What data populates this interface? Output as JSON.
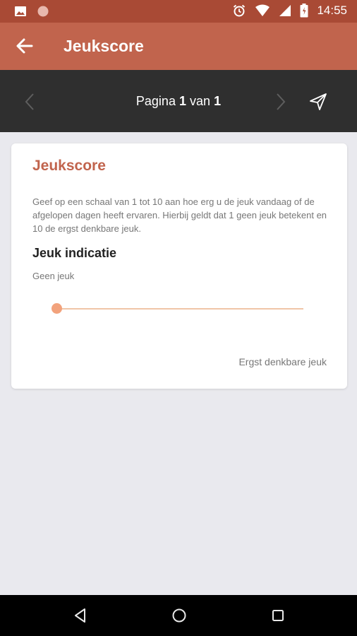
{
  "status_bar": {
    "time": "14:55",
    "left_icons": [
      "image-icon",
      "circle-notification-icon"
    ],
    "right_icons": [
      "alarm-icon",
      "wifi-icon",
      "signal-icon",
      "battery-icon"
    ]
  },
  "app_bar": {
    "title": "Jeukscore",
    "back_icon": "arrow-left-icon"
  },
  "pager": {
    "prefix": "Pagina",
    "current": "1",
    "separator": "van",
    "total": "1"
  },
  "card": {
    "title": "Jeukscore",
    "description": "Geef op een schaal van 1 tot 10 aan hoe erg u de jeuk vandaag of de afgelopen dagen heeft ervaren. Hierbij geldt dat 1 geen jeuk betekent en 10 de ergst denkbare jeuk.",
    "section_title": "Jeuk indicatie",
    "min_label": "Geen jeuk",
    "max_label": "Ergst denkbare jeuk",
    "slider_value": 0
  },
  "colors": {
    "status_bar": "#a94a35",
    "app_bar": "#c1644d",
    "pager_bar": "#2f2f2f",
    "accent_title": "#c1644d",
    "slider_track": "#f0c5a8",
    "slider_thumb": "#f2a27c",
    "background": "#e9e9ee"
  }
}
